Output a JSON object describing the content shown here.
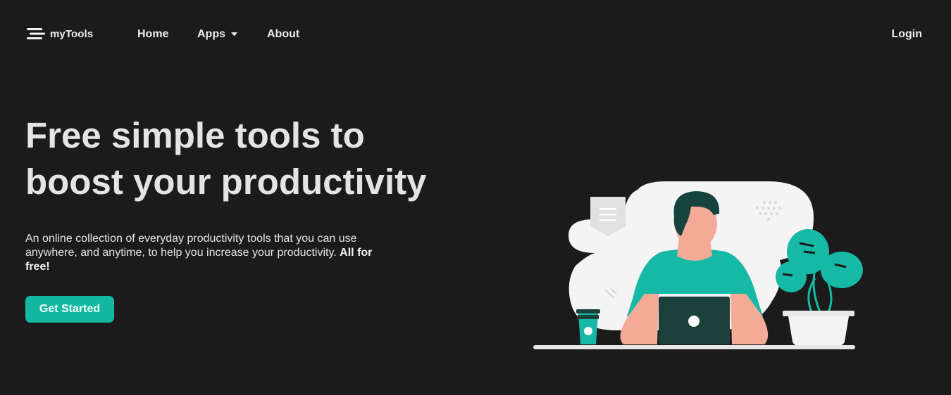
{
  "brand": {
    "name": "myTools",
    "icon": "hamburger-menu-icon"
  },
  "nav": {
    "home": "Home",
    "apps": "Apps",
    "about": "About",
    "login": "Login"
  },
  "hero": {
    "title_line1": "Free simple tools to",
    "title_line2": "boost your productivity",
    "description": "An online collection of everyday productivity tools that you can use anywhere, and anytime, to help you increase your productivity.",
    "description_bold": "All for free!",
    "cta": "Get Started"
  },
  "colors": {
    "background": "#1b1b1b",
    "accent": "#14b8a0",
    "text": "#e8e8e8"
  }
}
